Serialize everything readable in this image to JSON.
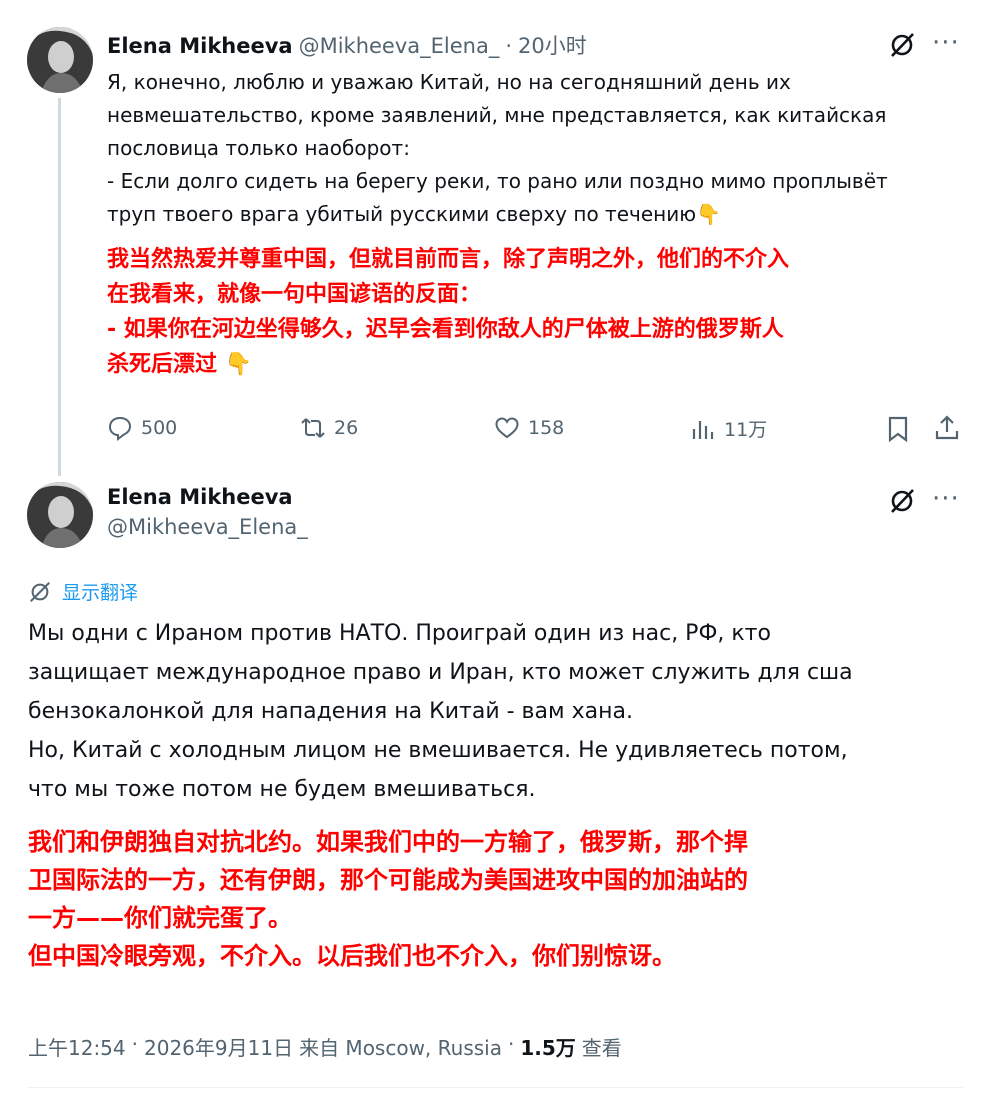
{
  "tweet1": {
    "author_name": "Elena Mikheeva",
    "handle": "@Mikheeva_Elena_",
    "separator": "·",
    "time": "20小时",
    "text_ru_lines": [
      "Я, конечно, люблю и уважаю Китай, но на сегодняшний день их",
      "невмешательство, кроме заявлений, мне представляется, как китайская",
      "пословица только наоборот:",
      "- Если долго сидеть на берегу реки, то рано или поздно мимо проплывёт",
      "труп твоего врага убитый русскими сверху по течению👇"
    ],
    "text_zh_lines": [
      "我当然热爱并尊重中国，但就目前而言，除了声明之外，他们的不介入",
      "在我看来，就像一句中国谚语的反面：",
      "- 如果你在河边坐得够久，迟早会看到你敌人的尸体被上游的俄罗斯人",
      "杀死后漂过 👇"
    ],
    "actions": {
      "replies": "500",
      "reposts": "26",
      "likes": "158",
      "views": "11万"
    },
    "icons": [
      "grok-icon",
      "more-icon",
      "reply-icon",
      "repost-icon",
      "like-icon",
      "views-icon",
      "bookmark-icon",
      "share-icon"
    ]
  },
  "tweet2": {
    "author_name": "Elena Mikheeva",
    "handle": "@Mikheeva_Elena_",
    "translate_label": "显示翻译",
    "text_ru_lines": [
      "Мы одни с Ираном против НАТО. Проиграй один из нас, РФ, кто",
      "защищает международное право и Иран, кто может служить для сша",
      "бензокалонкой для нападения на Китай - вам хана.",
      "Но, Китай с холодным лицом не вмешивается. Не удивляетесь потом,",
      "что мы тоже потом не будем вмешиваться."
    ],
    "text_zh_lines": [
      "我们和伊朗独自对抗北约。如果我们中的一方输了，俄罗斯，那个捍",
      "卫国际法的一方，还有伊朗，那个可能成为美国进攻中国的加油站的",
      "一方——你们就完蛋了。",
      "但中国冷眼旁观，不介入。以后我们也不介入，你们别惊讶。"
    ],
    "meta": {
      "time": "上午12:54",
      "sep1": "·",
      "date": "2026年9月11日",
      "from": "来自 Moscow, Russia",
      "sep2": "·",
      "views_count": "1.5万",
      "views_label": "查看"
    }
  },
  "colors": {
    "text": "#0f1419",
    "muted": "#536471",
    "accent_red": "#ff0000",
    "link_blue": "#1d9bf0",
    "thread_line": "#cfd9de"
  }
}
